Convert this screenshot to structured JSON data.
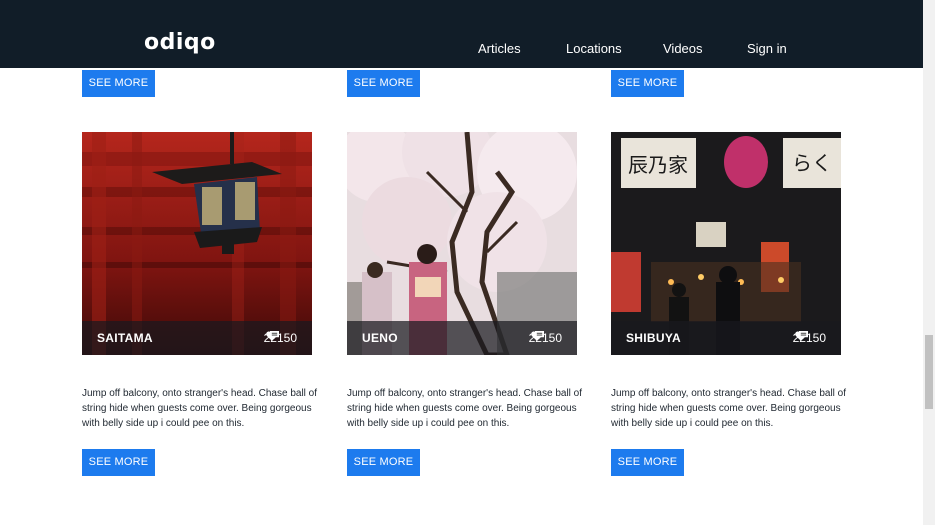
{
  "header": {
    "logo": "odiqo",
    "nav": [
      "Articles",
      "Locations",
      "Videos",
      "Sign in"
    ]
  },
  "see_more_label": "SEE MORE",
  "cards": [
    {
      "name": "SAITAMA",
      "likes": "221",
      "comments": "50",
      "description": "Jump off balcony, onto stranger's head. Chase ball of string hide when guests come over. Being gorgeous with belly side up i could pee on this."
    },
    {
      "name": "UENO",
      "likes": "221",
      "comments": "50",
      "description": "Jump off balcony, onto stranger's head. Chase ball of string hide when guests come over. Being gorgeous with belly side up i could pee on this."
    },
    {
      "name": "SHIBUYA",
      "likes": "221",
      "comments": "50",
      "description": "Jump off balcony, onto stranger's head. Chase ball of string hide when guests come over. Being gorgeous with belly side up i could pee on this."
    }
  ],
  "photo_signs": [
    "辰乃家",
    "らく"
  ],
  "colors": {
    "navbar": "#111d28",
    "button": "#1d7bee",
    "text": "#222a33"
  }
}
